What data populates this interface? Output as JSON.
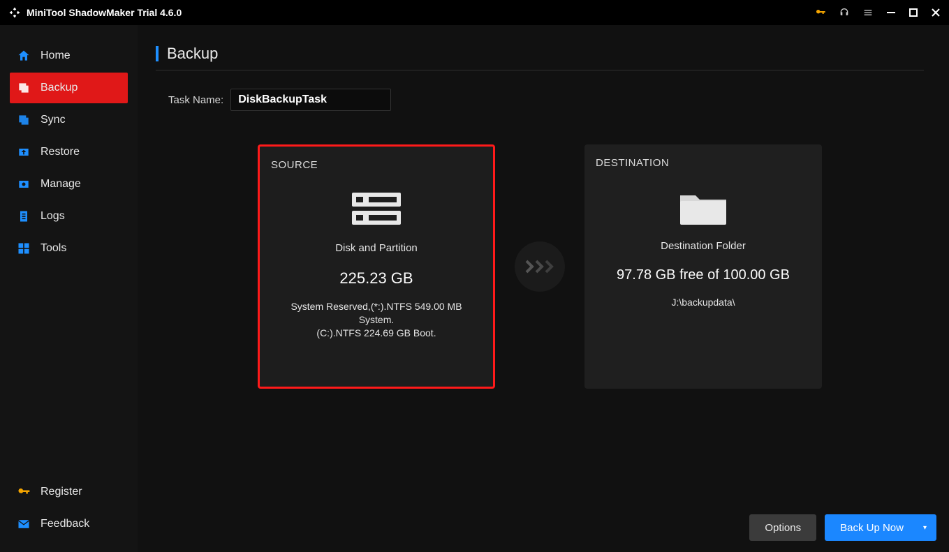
{
  "app_title": "MiniTool ShadowMaker Trial 4.6.0",
  "sidebar": {
    "items": [
      {
        "label": "Home"
      },
      {
        "label": "Backup"
      },
      {
        "label": "Sync"
      },
      {
        "label": "Restore"
      },
      {
        "label": "Manage"
      },
      {
        "label": "Logs"
      },
      {
        "label": "Tools"
      }
    ],
    "bottom": [
      {
        "label": "Register"
      },
      {
        "label": "Feedback"
      }
    ]
  },
  "page": {
    "title": "Backup",
    "task_name_label": "Task Name:",
    "task_name_value": "DiskBackupTask"
  },
  "source": {
    "title": "SOURCE",
    "type_label": "Disk and Partition",
    "size": "225.23 GB",
    "details_line1": "System Reserved,(*:).NTFS 549.00 MB System.",
    "details_line2": "(C:).NTFS 224.69 GB Boot."
  },
  "destination": {
    "title": "DESTINATION",
    "type_label": "Destination Folder",
    "free_line": "97.78 GB free of 100.00 GB",
    "path": "J:\\backupdata\\"
  },
  "buttons": {
    "options": "Options",
    "backup_now": "Back Up Now"
  }
}
